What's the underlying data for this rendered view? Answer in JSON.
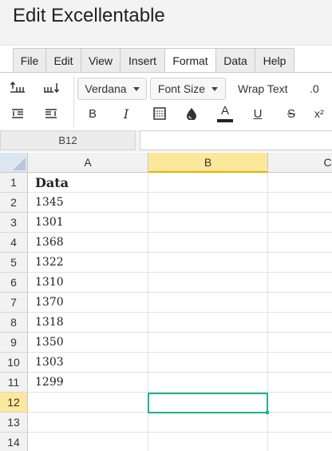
{
  "app": {
    "title": "Edit Excellentable"
  },
  "menu": {
    "tabs": [
      {
        "label": "File"
      },
      {
        "label": "Edit"
      },
      {
        "label": "View"
      },
      {
        "label": "Insert"
      },
      {
        "label": "Format"
      },
      {
        "label": "Data"
      },
      {
        "label": "Help"
      }
    ],
    "active": "Format"
  },
  "toolbar": {
    "font_family": "Verdana",
    "font_size": "Font Size",
    "wrap_text": "Wrap Text",
    "decimal": ".0",
    "bold": "B",
    "italic": "I",
    "underline": "U",
    "strikethrough": "S",
    "superscript": "x²",
    "text_color": "A",
    "icons": [
      "insert-row-above-icon",
      "insert-column-left-icon",
      "insert-row-below-icon",
      "insert-column-right-icon",
      "borders-icon",
      "fill-color-icon",
      "text-color-icon"
    ]
  },
  "formula_bar": {
    "cell_ref": "B12",
    "value": ""
  },
  "sheet": {
    "columns": [
      "A",
      "B",
      "C"
    ],
    "selected_column": "B",
    "selected_row": "12",
    "rows": [
      {
        "num": "1",
        "a": "Data",
        "b": ""
      },
      {
        "num": "2",
        "a": "1345",
        "b": ""
      },
      {
        "num": "3",
        "a": "1301",
        "b": ""
      },
      {
        "num": "4",
        "a": "1368",
        "b": ""
      },
      {
        "num": "5",
        "a": "1322",
        "b": ""
      },
      {
        "num": "6",
        "a": "1310",
        "b": ""
      },
      {
        "num": "7",
        "a": "1370",
        "b": ""
      },
      {
        "num": "8",
        "a": "1318",
        "b": ""
      },
      {
        "num": "9",
        "a": "1350",
        "b": ""
      },
      {
        "num": "10",
        "a": "1303",
        "b": ""
      },
      {
        "num": "11",
        "a": "1299",
        "b": ""
      },
      {
        "num": "12",
        "a": "",
        "b": ""
      },
      {
        "num": "13",
        "a": "",
        "b": ""
      },
      {
        "num": "14",
        "a": "",
        "b": ""
      }
    ],
    "selection_color": "#20b38a",
    "header_highlight_color": "#fde79b"
  }
}
